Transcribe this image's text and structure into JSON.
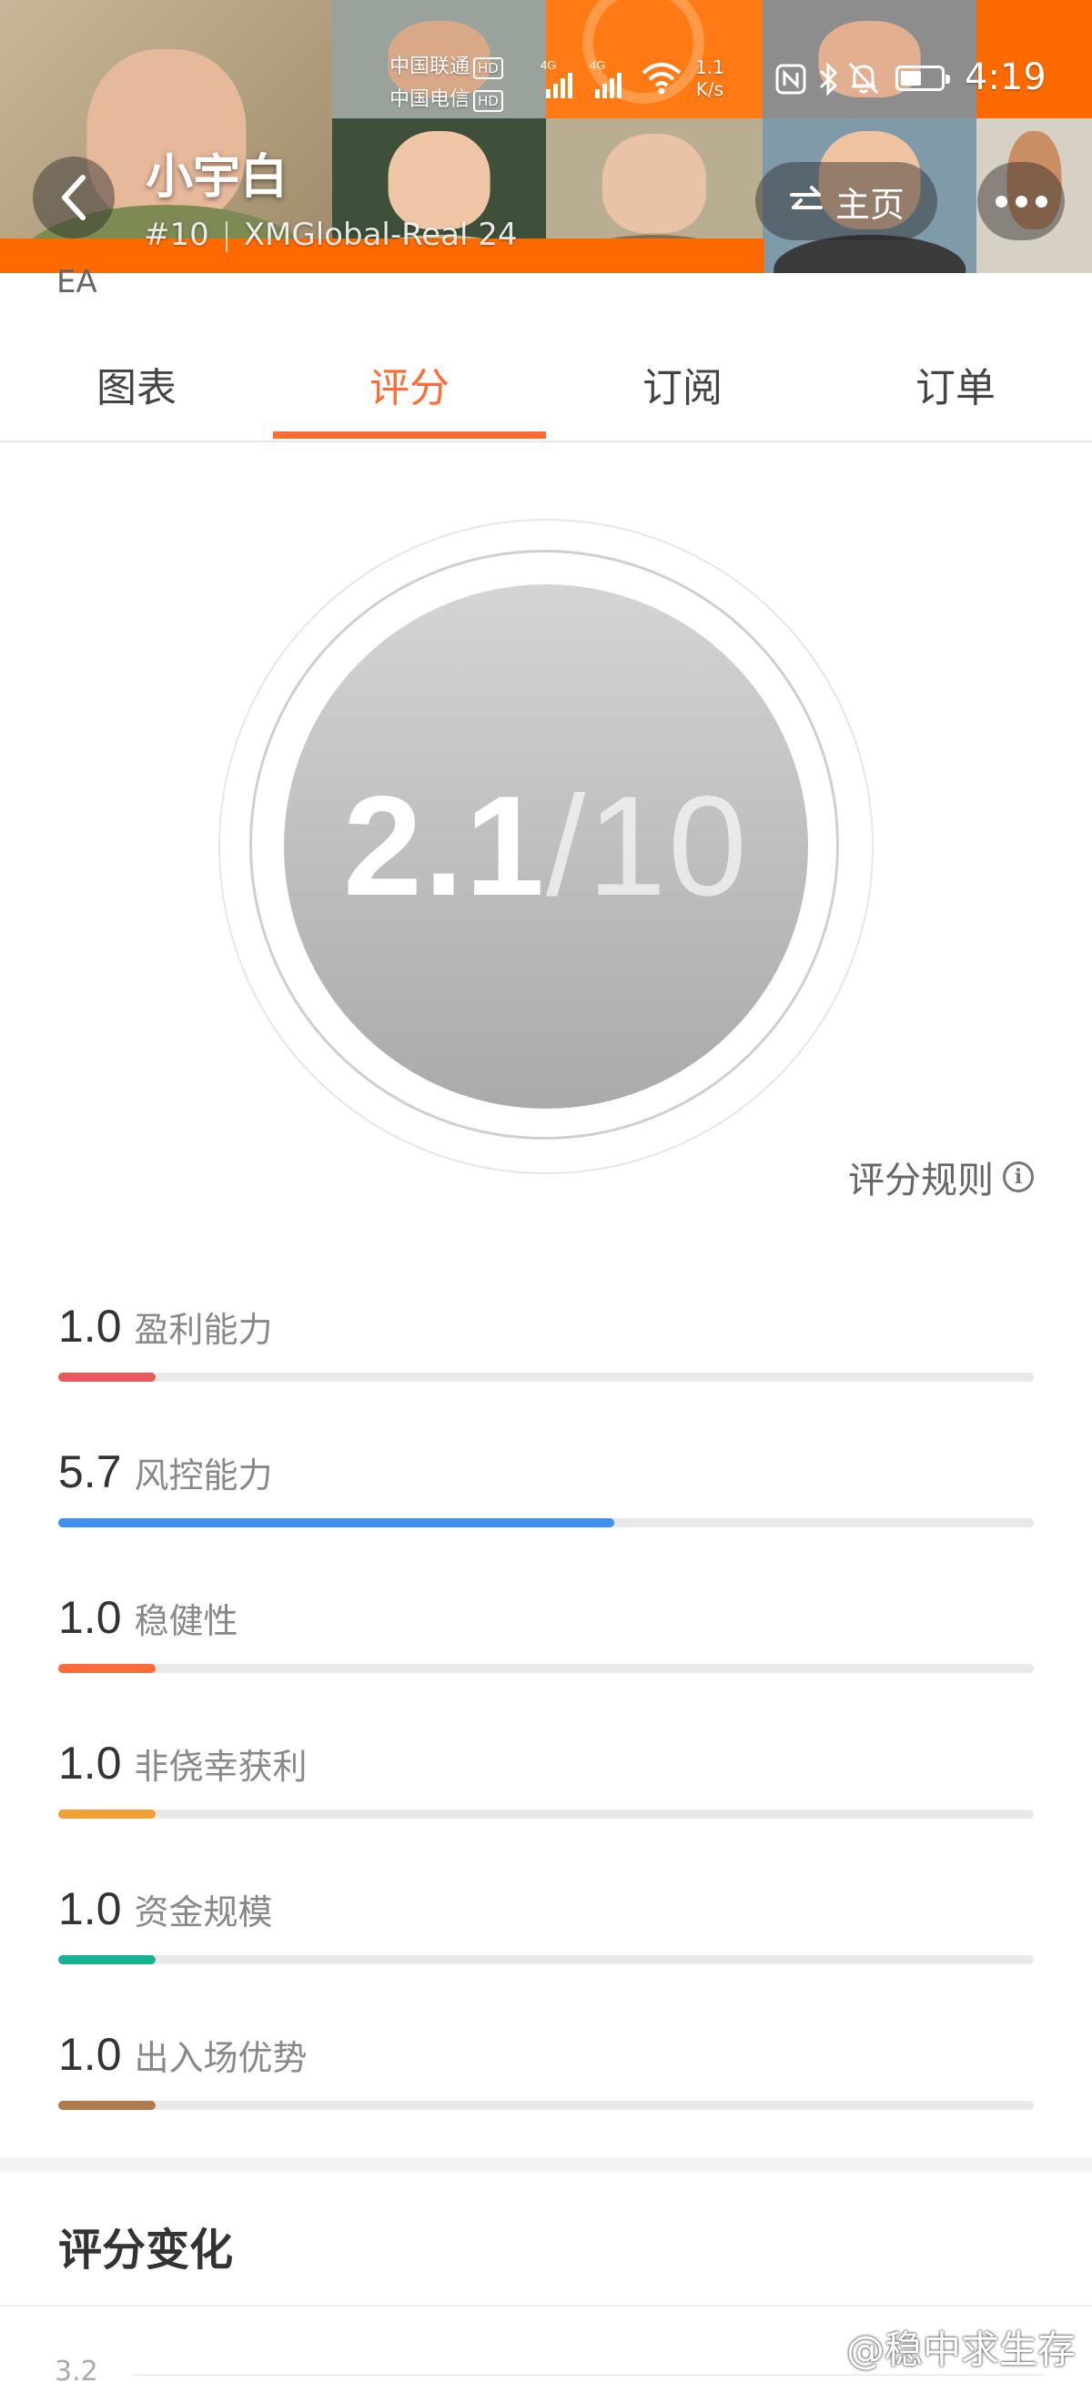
{
  "status_bar": {
    "carrier1": "中国联通",
    "carrier2": "中国电信",
    "hd": "HD",
    "net_type": "4G",
    "speed_value": "1.1",
    "speed_unit": "K/s",
    "time": "4:19"
  },
  "header": {
    "title": "小宇白",
    "rank": "#10",
    "account": "XMGlobal-Real 24",
    "home_label": "主页",
    "partial_text": "EA"
  },
  "tabs": [
    {
      "label": "图表"
    },
    {
      "label": "评分"
    },
    {
      "label": "订阅"
    },
    {
      "label": "订单"
    }
  ],
  "score": {
    "value": "2.1",
    "denominator": "/10",
    "rules_label": "评分规则"
  },
  "metrics": [
    {
      "value": "1.0",
      "label": "盈利能力",
      "fraction": 0.1,
      "color": "#e85a5a"
    },
    {
      "value": "5.7",
      "label": "风控能力",
      "fraction": 0.57,
      "color": "#3f8ef0"
    },
    {
      "value": "1.0",
      "label": "稳健性",
      "fraction": 0.1,
      "color": "#ff6a3a"
    },
    {
      "value": "1.0",
      "label": "非侥幸获利",
      "fraction": 0.1,
      "color": "#f0a035"
    },
    {
      "value": "1.0",
      "label": "资金规模",
      "fraction": 0.1,
      "color": "#15b391"
    },
    {
      "value": "1.0",
      "label": "出入场优势",
      "fraction": 0.1,
      "color": "#b07a4a"
    }
  ],
  "score_change": {
    "title": "评分变化",
    "first_tick": "3.2"
  },
  "watermark": "@稳中求生存",
  "colors": {
    "accent": "#ff6a35",
    "banner_orange": "#ff6a00"
  }
}
